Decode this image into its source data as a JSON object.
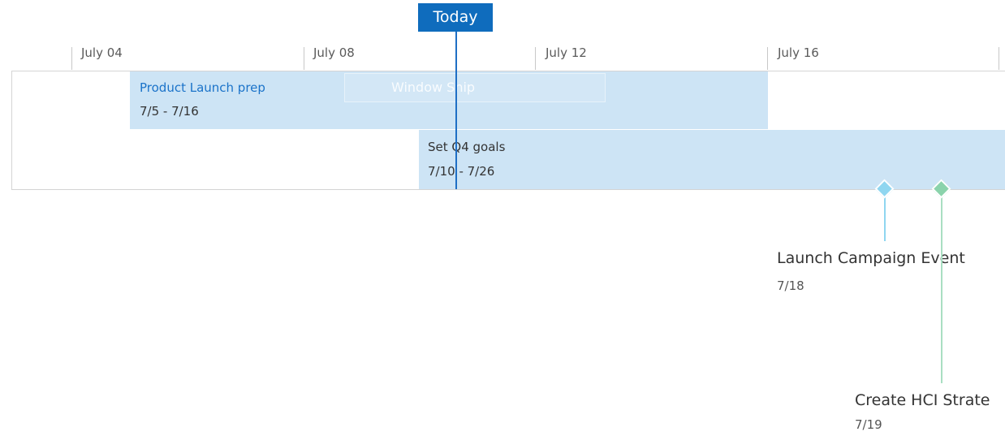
{
  "axis": {
    "ticks": [
      "July 04",
      "July 08",
      "July 12",
      "July 16"
    ]
  },
  "today": {
    "label": "Today"
  },
  "tasks": [
    {
      "title": "Product Launch prep",
      "dates": "7/5 - 7/16",
      "title_color": "#1b73c9",
      "bar_color": "#cde4f5"
    },
    {
      "title": "Set Q4 goals",
      "dates": "7/10 - 7/26",
      "title_color": "#333333",
      "bar_color": "#cde4f5"
    }
  ],
  "overlay": {
    "text": "Window Snip"
  },
  "milestones": [
    {
      "title": "Launch Campaign Event",
      "date": "7/18",
      "color": "#8fd6f0"
    },
    {
      "title": "Create HCI Strate",
      "date": "7/19",
      "color": "#8ad3ab"
    }
  ],
  "colors": {
    "accent": "#0f6cbd",
    "today_line": "#1f6fc5"
  }
}
